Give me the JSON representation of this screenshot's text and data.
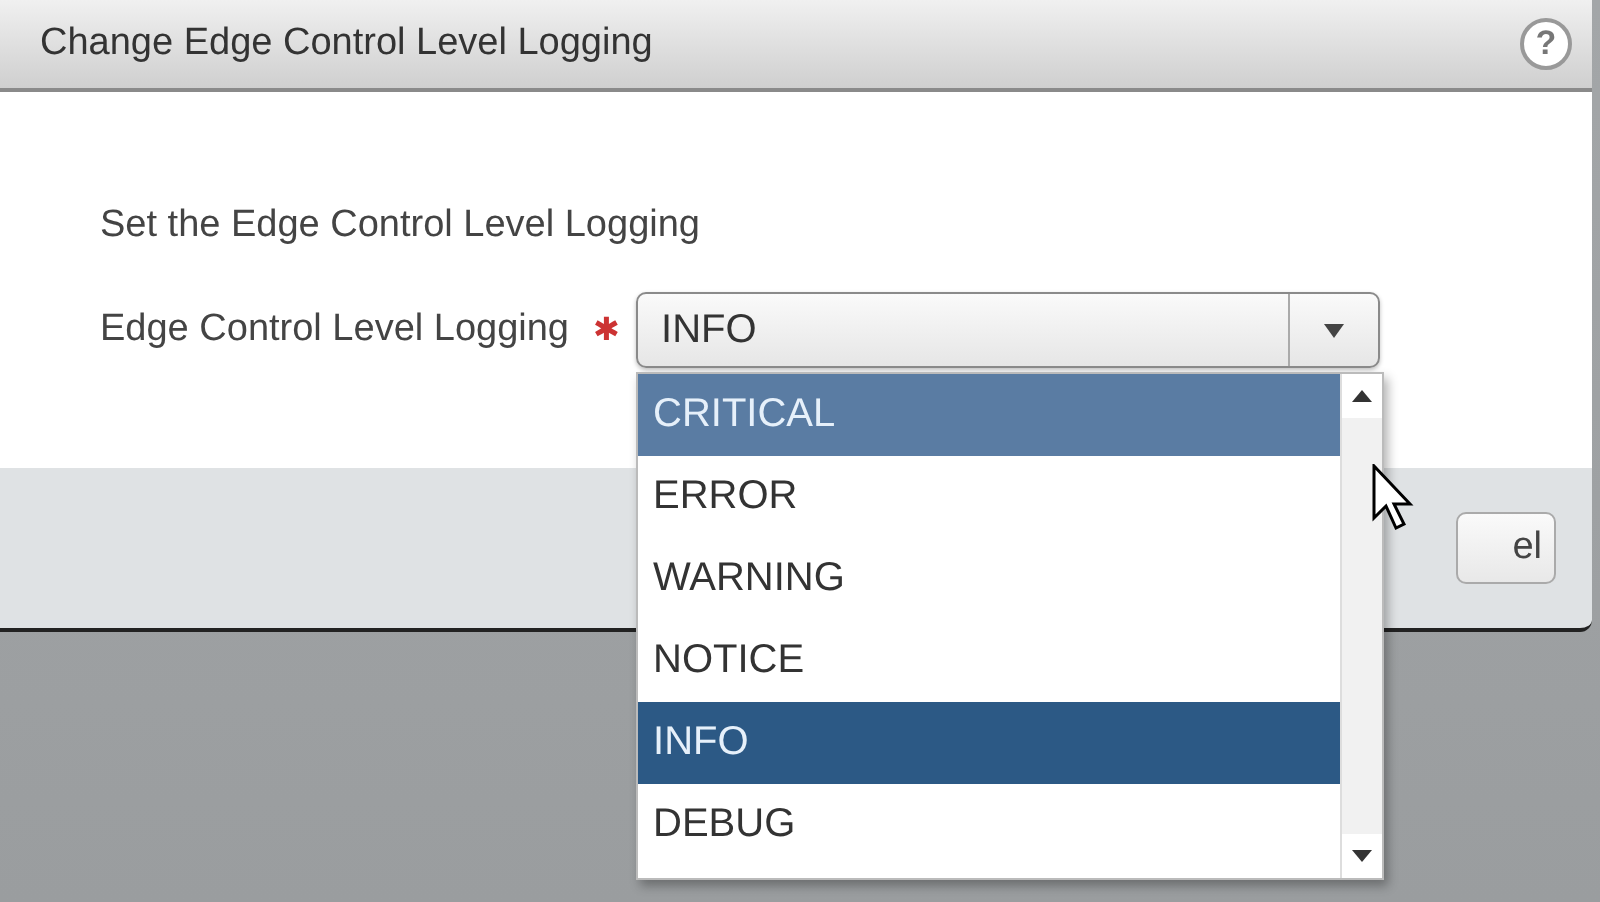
{
  "dialog": {
    "title": "Change Edge Control Level Logging",
    "help": "?",
    "intro": "Set the Edge Control Level Logging",
    "field": {
      "label": "Edge Control Level Logging",
      "required_mark": "✱",
      "value": "INFO",
      "expanded": true,
      "options": [
        {
          "label": "CRITICAL",
          "hovered": true,
          "selected": false
        },
        {
          "label": "ERROR",
          "hovered": false,
          "selected": false
        },
        {
          "label": "WARNING",
          "hovered": false,
          "selected": false
        },
        {
          "label": "NOTICE",
          "hovered": false,
          "selected": false
        },
        {
          "label": "INFO",
          "hovered": false,
          "selected": true
        },
        {
          "label": "DEBUG",
          "hovered": false,
          "selected": false
        }
      ]
    },
    "buttons": [
      "el"
    ]
  }
}
